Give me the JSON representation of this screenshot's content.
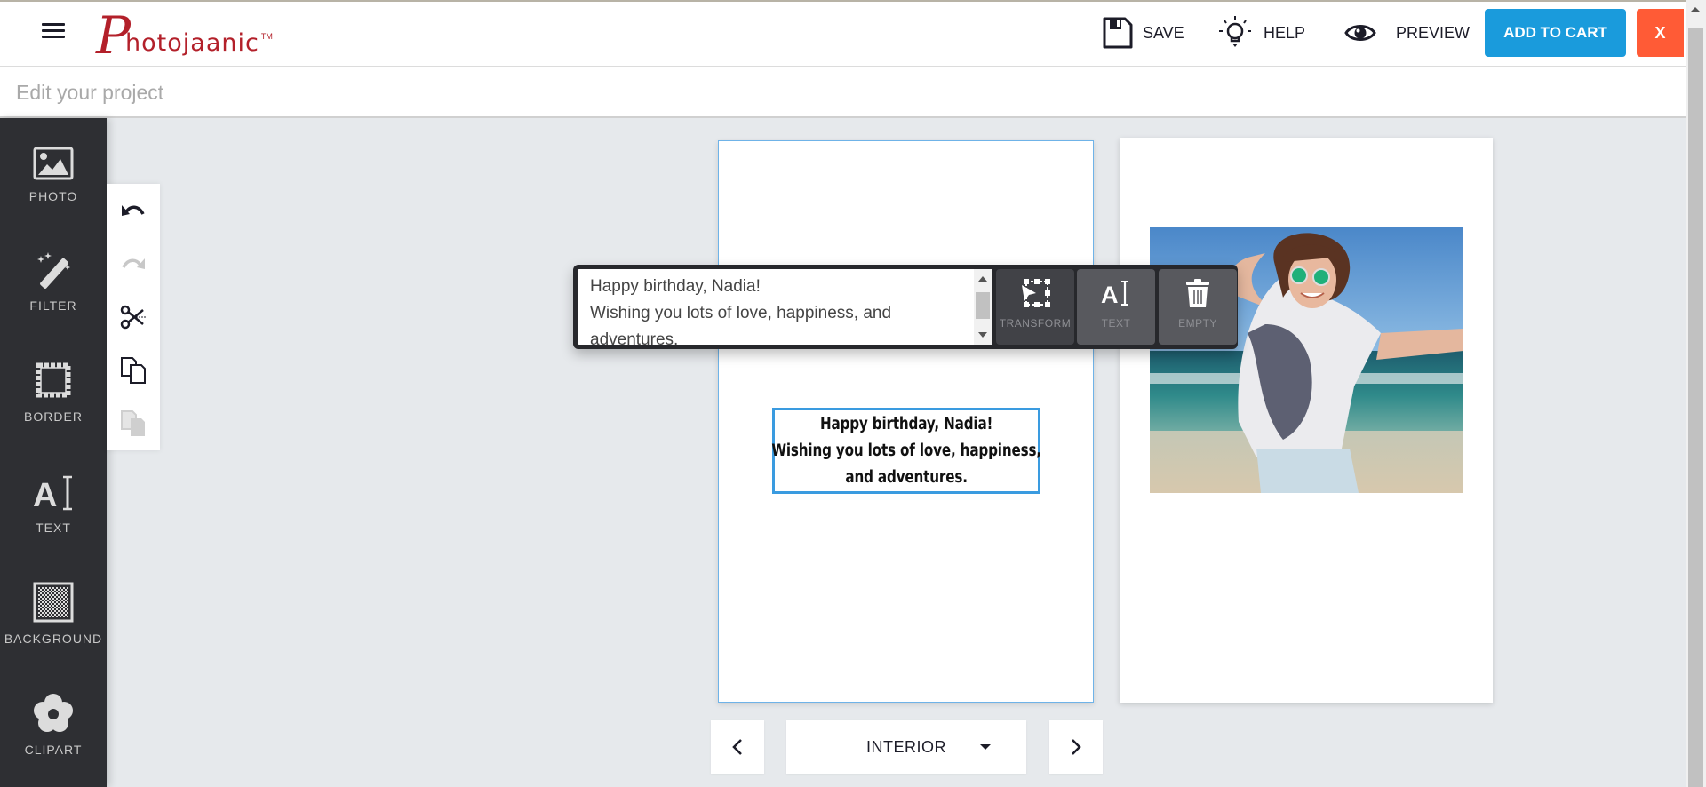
{
  "header": {
    "logo_initial": "P",
    "logo_rest": "hotojaanic",
    "logo_tm": "TM",
    "save_label": "SAVE",
    "help_label": "HELP",
    "preview_label": "PREVIEW",
    "add_to_cart_label": "ADD TO CART",
    "close_label": "X"
  },
  "project_bar": {
    "title": "Edit your project"
  },
  "sidebar": {
    "items": [
      {
        "label": "PHOTO",
        "icon": "photo-icon"
      },
      {
        "label": "FILTER",
        "icon": "magic-wand-icon"
      },
      {
        "label": "BORDER",
        "icon": "border-icon"
      },
      {
        "label": "TEXT",
        "icon": "text-icon"
      },
      {
        "label": "BACKGROUND",
        "icon": "background-icon"
      },
      {
        "label": "CLIPART",
        "icon": "flower-icon"
      }
    ]
  },
  "edit_toolbar": {
    "tools": [
      {
        "name": "undo",
        "enabled": true
      },
      {
        "name": "redo",
        "enabled": false
      },
      {
        "name": "cut",
        "enabled": true
      },
      {
        "name": "copy",
        "enabled": true
      },
      {
        "name": "paste",
        "enabled": false
      }
    ]
  },
  "text_popup": {
    "text_value": "Happy birthday, Nadia!\nWishing you lots of love, happiness, and adventures.",
    "transform_label": "TRANSFORM",
    "text_label": "TEXT",
    "empty_label": "EMPTY"
  },
  "canvas": {
    "text_box": {
      "line1": "Happy birthday, Nadia!",
      "line2": "Wishing you lots of love, happiness,",
      "line3": "and adventures."
    },
    "photo_description": "Smiling woman with green sunglasses and white graphic t-shirt jumping on a beach"
  },
  "page_nav": {
    "selected_page": "INTERIOR"
  },
  "colors": {
    "brand_red": "#b3202a",
    "cart_blue": "#1a9bdc",
    "close_orange": "#ff5b36",
    "sidebar_dark": "#2e2f33",
    "selection_blue": "#3a9be0"
  }
}
